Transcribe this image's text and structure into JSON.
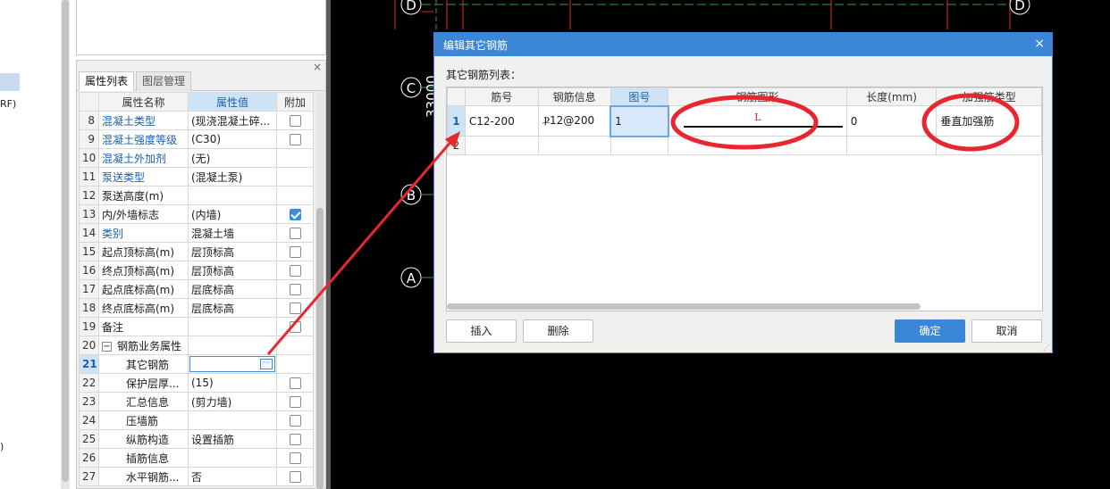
{
  "left_strip": {
    "fragments": [
      "RF)",
      ")"
    ]
  },
  "property_panel": {
    "close_glyph": "×",
    "tabs": [
      {
        "label": "属性列表",
        "active": true
      },
      {
        "label": "图层管理",
        "active": false
      }
    ],
    "headers": {
      "name": "属性名称",
      "value": "属性值",
      "extra": "附加"
    },
    "rows": [
      {
        "num": "8",
        "name": "混凝土类型",
        "value": "(现浇混凝土碎...",
        "checkbox": "off",
        "blue": true
      },
      {
        "num": "9",
        "name": "混凝土强度等级",
        "value": "(C30)",
        "checkbox": "off",
        "blue": true
      },
      {
        "num": "10",
        "name": "混凝土外加剂",
        "value": "(无)",
        "checkbox": "none",
        "blue": true
      },
      {
        "num": "11",
        "name": "泵送类型",
        "value": "(混凝土泵)",
        "checkbox": "none",
        "blue": true
      },
      {
        "num": "12",
        "name": "泵送高度(m)",
        "value": "",
        "checkbox": "none",
        "blue": false
      },
      {
        "num": "13",
        "name": "内/外墙标志",
        "value": "(内墙)",
        "checkbox": "on",
        "blue": false
      },
      {
        "num": "14",
        "name": "类别",
        "value": "混凝土墙",
        "checkbox": "off",
        "blue": true
      },
      {
        "num": "15",
        "name": "起点顶标高(m)",
        "value": "层顶标高",
        "checkbox": "off",
        "blue": false
      },
      {
        "num": "16",
        "name": "终点顶标高(m)",
        "value": "层顶标高",
        "checkbox": "off",
        "blue": false
      },
      {
        "num": "17",
        "name": "起点底标高(m)",
        "value": "层底标高",
        "checkbox": "off",
        "blue": false
      },
      {
        "num": "18",
        "name": "终点底标高(m)",
        "value": "层底标高",
        "checkbox": "off",
        "blue": false
      },
      {
        "num": "19",
        "name": "备注",
        "value": "",
        "checkbox": "off",
        "blue": false
      },
      {
        "num": "20",
        "name": "钢筋业务属性",
        "value": "",
        "checkbox": "none",
        "blue": false,
        "group": true,
        "expander": "−"
      },
      {
        "num": "21",
        "name": "其它钢筋",
        "value": "",
        "checkbox": "none",
        "blue": false,
        "indent": true,
        "selected": true,
        "editor": "···"
      },
      {
        "num": "22",
        "name": "保护层厚...",
        "value": "(15)",
        "checkbox": "off",
        "blue": false,
        "indent": true
      },
      {
        "num": "23",
        "name": "汇总信息",
        "value": "(剪力墙)",
        "checkbox": "off",
        "blue": false,
        "indent": true
      },
      {
        "num": "24",
        "name": "压墙筋",
        "value": "",
        "checkbox": "off",
        "blue": false,
        "indent": true
      },
      {
        "num": "25",
        "name": "纵筋构造",
        "value": "设置插筋",
        "checkbox": "off",
        "blue": false,
        "indent": true
      },
      {
        "num": "26",
        "name": "插筋信息",
        "value": "",
        "checkbox": "off",
        "blue": false,
        "indent": true
      },
      {
        "num": "27",
        "name": "水平钢筋...",
        "value": "否",
        "checkbox": "off",
        "blue": false,
        "indent": true
      }
    ]
  },
  "cad": {
    "axis_labels": [
      "D",
      "D",
      "C",
      "B",
      "A"
    ],
    "dimension": "33000",
    "line_color": "#e0232d",
    "axis_color": "#2e9e3a"
  },
  "dialog": {
    "title": "编辑其它钢筋",
    "close_glyph": "×",
    "list_label": "其它钢筋列表：",
    "columns": [
      "",
      "筋号",
      "钢筋信息",
      "图号",
      "钢筋图形",
      "长度(mm)",
      "加强筋类型"
    ],
    "rows": [
      {
        "row": "1",
        "bar_no": "C12-200",
        "rebar_info": "Ⳁ12@200",
        "fig_no": "1",
        "shape_label": "L",
        "length": "0",
        "type": "垂直加强筋",
        "selected": true
      },
      {
        "row": "2",
        "bar_no": "",
        "rebar_info": "",
        "fig_no": "",
        "shape_label": "",
        "length": "",
        "type": "",
        "selected": false
      }
    ],
    "buttons": {
      "insert": "插入",
      "delete": "删除",
      "ok": "确定",
      "cancel": "取消"
    }
  },
  "annotation_color": "#e8262d"
}
